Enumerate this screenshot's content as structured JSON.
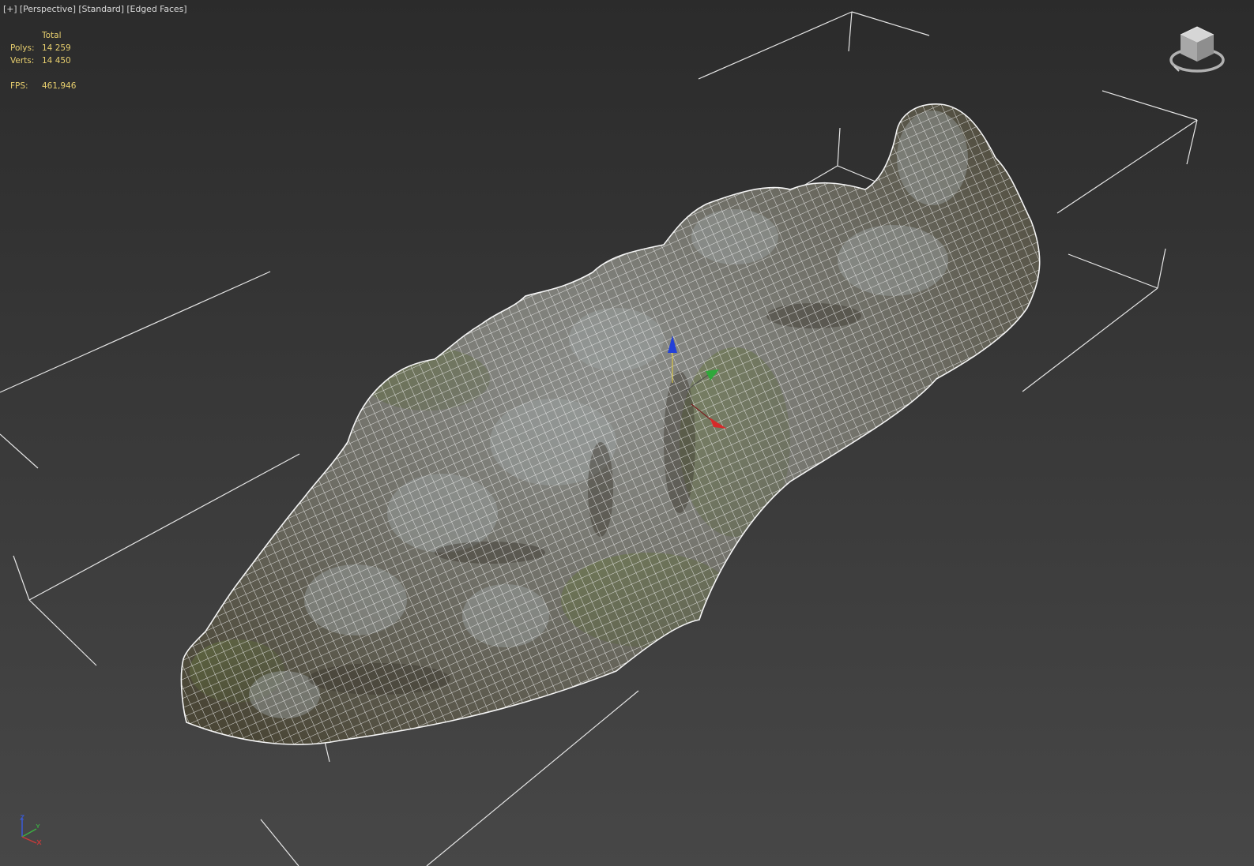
{
  "viewport": {
    "menu_label": "[+]",
    "pov_label": "[Perspective]",
    "shading_label": "[Standard]",
    "display_label": "[Edged Faces]"
  },
  "stats": {
    "header": "Total",
    "polys_label": "Polys:",
    "polys_value": "14 259",
    "verts_label": "Verts:",
    "verts_value": "14 450",
    "fps_label": "FPS:",
    "fps_value": "461,946"
  },
  "viewcube": {
    "icon": "viewcube-icon"
  },
  "axis_tripod": {
    "icon": "axis-tripod-icon",
    "x_color": "#c83a3a",
    "y_color": "#3cb043",
    "z_color": "#3a5ad8"
  },
  "colors": {
    "wire": "#f2f2f2",
    "bbox": "#e6e6e6",
    "stats_text": "#e8cf6e"
  }
}
